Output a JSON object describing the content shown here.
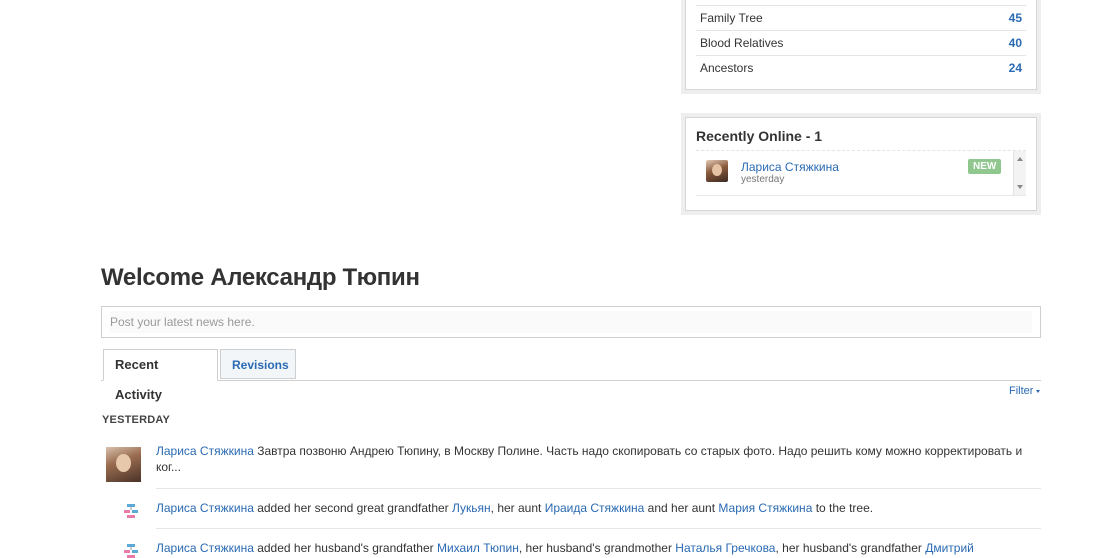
{
  "stats": [
    {
      "label": "Family Tree",
      "count": "45"
    },
    {
      "label": "Blood Relatives",
      "count": "40"
    },
    {
      "label": "Ancestors",
      "count": "24"
    }
  ],
  "online": {
    "title": "Recently Online - 1",
    "user_name": "Лариса Стяжкина",
    "user_time": "yesterday",
    "badge": "NEW"
  },
  "welcome": "Welcome Александр Тюпин",
  "news_placeholder": "Post your latest news here.",
  "tabs": {
    "recent": "Recent Activity",
    "revisions": "Revisions"
  },
  "filter": "Filter",
  "day_heading": "YESTERDAY",
  "activity": [
    {
      "user": "Лариса Стяжкина",
      "text": " Завтра позвоню Андрею Тюпину, в Москву Полине. Часть надо скопировать со старых фото. Надо решить кому можно корректировать и ког..."
    },
    {
      "user": "Лариса Стяжкина",
      "t1": " added her second great grandfather ",
      "p1": "Лукьян",
      "t2": ", her aunt ",
      "p2": "Ираида Стяжкина",
      "t3": " and her aunt ",
      "p3": "Мария Стяжкина",
      "t4": " to the tree."
    },
    {
      "user": "Лариса Стяжкина",
      "t1": " added her husband's grandfather ",
      "p1": "Михаил Тюпин",
      "t2": ", her husband's grandmother ",
      "p2": "Наталья Гречкова",
      "t3": ", her husband's grandfather ",
      "p3": "Дмитрий"
    }
  ],
  "colors": {
    "link": "#2a6ab3",
    "badge": "#8fc78f",
    "tree_icon_pink": "#e87aa8",
    "tree_icon_blue": "#5aa9d6"
  }
}
